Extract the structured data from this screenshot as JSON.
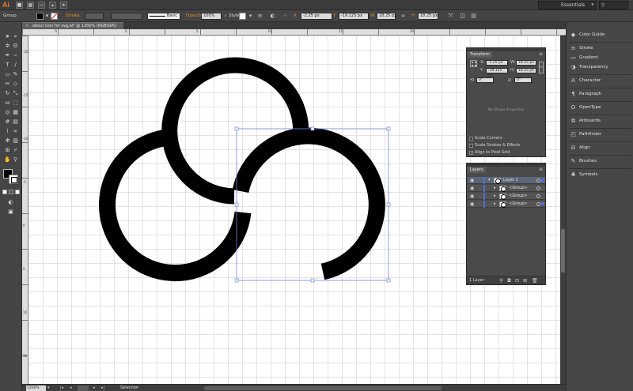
{
  "app": {
    "logo": "Ai",
    "workspace": "Essentials"
  },
  "control_bar": {
    "selection_type": "Group",
    "stroke_label": "Stroke",
    "stroke_style": "Basic",
    "opacity_label": "Opacity",
    "opacity_value": "100%",
    "style_label": "Style",
    "x_value": "-2.25 px",
    "y_value": "-19.125 px",
    "w_value": "18.25 px",
    "h_value": "18.25 px",
    "x_label": "X",
    "y_label": "Y",
    "w_label": "W",
    "h_label": "H"
  },
  "document": {
    "tab_title": "about icon for svg.ai* @ 1200% (RGB/GPU Preview)",
    "zoom": "1200%",
    "status": "Selection"
  },
  "rulers": {
    "top": [
      "-5",
      "0",
      "5",
      "10",
      "15",
      "20"
    ],
    "left": [
      "-20",
      "-15",
      "-10",
      "-5",
      "0",
      "5",
      "10",
      "15"
    ]
  },
  "dock": {
    "items": [
      {
        "label": "Color Guide",
        "icon": "color-guide-icon"
      },
      {
        "label": "Stroke",
        "icon": "stroke-icon"
      },
      {
        "label": "Gradient",
        "icon": "gradient-icon"
      },
      {
        "label": "Transparency",
        "icon": "transparency-icon"
      },
      {
        "label": "Character",
        "icon": "character-icon"
      },
      {
        "label": "Paragraph",
        "icon": "paragraph-icon"
      },
      {
        "label": "OpenType",
        "icon": "opentype-icon"
      },
      {
        "label": "Artboards",
        "icon": "artboards-icon"
      },
      {
        "label": "Pathfinder",
        "icon": "pathfinder-icon"
      },
      {
        "label": "Align",
        "icon": "align-icon"
      },
      {
        "label": "Brushes",
        "icon": "brushes-icon"
      },
      {
        "label": "Symbols",
        "icon": "symbols-icon"
      }
    ]
  },
  "transform_panel": {
    "title": "Transform",
    "x_label": "X:",
    "y_label": "Y:",
    "w_label": "W:",
    "h_label": "H:",
    "x": "-2.25 px",
    "y": "-19.125 px",
    "w": "18.25 px",
    "h": "18.25 px",
    "rotate": "0°",
    "shear": "0°",
    "no_shape": "No Shape Properties",
    "options": [
      {
        "label": "Scale Corners",
        "checked": false
      },
      {
        "label": "Scale Strokes & Effects",
        "checked": false
      },
      {
        "label": "Align to Pixel Grid",
        "checked": true
      }
    ]
  },
  "layers_panel": {
    "title": "Layers",
    "rows": [
      {
        "name": "Layer 1",
        "level": 0,
        "selected": true
      },
      {
        "name": "<Group>",
        "level": 1,
        "selected": false
      },
      {
        "name": "<Group>",
        "level": 1,
        "selected": false
      },
      {
        "name": "<Group>",
        "level": 1,
        "selected": false
      }
    ],
    "count": "1 Layer"
  },
  "colors": {
    "accent_orange": "#e0902c",
    "selection_blue": "#4d6fd8",
    "artwork": "#000000"
  }
}
